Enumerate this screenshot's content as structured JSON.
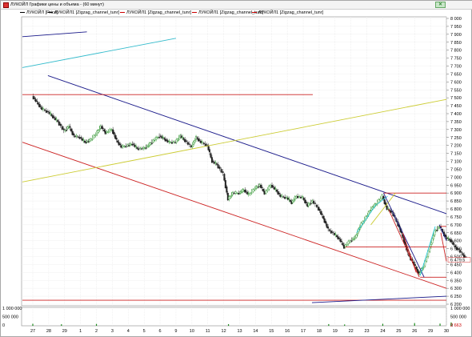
{
  "window": {
    "title": "ЛУКОЙЛ Графики цены и объема - (60 минут)",
    "close_label": "✕"
  },
  "legend": [
    {
      "label": "ЛУКОЙЛ [Price]",
      "color": "#000000"
    },
    {
      "label": "ЛУКОЙЛ1 [Zigzag_channel_tunr]",
      "color": "#000000"
    },
    {
      "label": "ЛУКОЙЛ1 [Zigzag_channel_tunr]",
      "color": "#cc0000"
    },
    {
      "label": "ЛУКОЙЛ1 [Zigzag_channel_tunr]",
      "color": "#cc0000"
    },
    {
      "label": "ЛУКОЙЛ1 [Zigzag_channel_tunr]",
      "color": "#cc0000"
    }
  ],
  "chart_data": {
    "type": "line",
    "series_type": "candlestick",
    "y_axis": {
      "ticks": [
        "8 000",
        "7 950",
        "7 900",
        "7 850",
        "7 800",
        "7 750",
        "7 700",
        "7 650",
        "7 600",
        "7 550",
        "7 500",
        "7 450",
        "7 400",
        "7 350",
        "7 300",
        "7 250",
        "7 200",
        "7 150",
        "7 100",
        "7 050",
        "7 000",
        "6 950",
        "6 900",
        "6 850",
        "6 800",
        "6 750",
        "6 700",
        "6 650",
        "6 600",
        "6 550",
        "6 500",
        "6 450",
        "6 400",
        "6 350",
        "6 300",
        "6 250",
        "6 200"
      ],
      "range": [
        6200,
        8000
      ],
      "step": 50
    },
    "x_axis": {
      "ticks": [
        "27",
        "28",
        "29",
        "1",
        "2",
        "3",
        "4",
        "5",
        "6",
        "9",
        "10",
        "11",
        "12",
        "13",
        "14",
        "15",
        "16",
        "17",
        "18",
        "19",
        "22",
        "23",
        "24",
        "25",
        "26",
        "29",
        "30"
      ]
    },
    "last_price_label": "6 479.5",
    "volume": {
      "ticks": [
        "1 000 000",
        "500 000",
        "0"
      ],
      "last_label": "2 663",
      "range": [
        0,
        1000000
      ]
    },
    "price_path": [
      [
        0,
        7510
      ],
      [
        0.3,
        7470
      ],
      [
        0.6,
        7430
      ],
      [
        1,
        7410
      ],
      [
        1.3,
        7380
      ],
      [
        1.6,
        7350
      ],
      [
        2,
        7290
      ],
      [
        2.3,
        7320
      ],
      [
        2.6,
        7260
      ],
      [
        3,
        7250
      ],
      [
        3.3,
        7220
      ],
      [
        3.6,
        7230
      ],
      [
        4,
        7270
      ],
      [
        4.3,
        7320
      ],
      [
        4.6,
        7280
      ],
      [
        5,
        7300
      ],
      [
        5.3,
        7230
      ],
      [
        5.6,
        7190
      ],
      [
        6,
        7200
      ],
      [
        6.3,
        7210
      ],
      [
        6.6,
        7180
      ],
      [
        7,
        7180
      ],
      [
        7.3,
        7200
      ],
      [
        7.6,
        7230
      ],
      [
        8,
        7260
      ],
      [
        8.3,
        7240
      ],
      [
        8.6,
        7220
      ],
      [
        9,
        7220
      ],
      [
        9.3,
        7260
      ],
      [
        9.6,
        7230
      ],
      [
        10,
        7190
      ],
      [
        10.3,
        7250
      ],
      [
        10.6,
        7220
      ],
      [
        11,
        7200
      ],
      [
        11.3,
        7100
      ],
      [
        11.6,
        7080
      ],
      [
        12,
        7020
      ],
      [
        12.3,
        6860
      ],
      [
        12.6,
        6900
      ],
      [
        13,
        6900
      ],
      [
        13.3,
        6920
      ],
      [
        13.6,
        6890
      ],
      [
        14,
        6930
      ],
      [
        14.3,
        6950
      ],
      [
        14.6,
        6900
      ],
      [
        15,
        6950
      ],
      [
        15.3,
        6920
      ],
      [
        15.6,
        6880
      ],
      [
        16,
        6870
      ],
      [
        16.3,
        6840
      ],
      [
        16.6,
        6880
      ],
      [
        17,
        6870
      ],
      [
        17.3,
        6820
      ],
      [
        17.6,
        6850
      ],
      [
        18,
        6800
      ],
      [
        18.3,
        6740
      ],
      [
        18.6,
        6670
      ],
      [
        19,
        6640
      ],
      [
        19.3,
        6610
      ],
      [
        19.6,
        6560
      ],
      [
        20,
        6600
      ],
      [
        20.3,
        6620
      ],
      [
        20.6,
        6690
      ],
      [
        21,
        6750
      ],
      [
        21.3,
        6800
      ],
      [
        21.6,
        6830
      ],
      [
        22,
        6880
      ],
      [
        22.3,
        6800
      ],
      [
        22.6,
        6780
      ],
      [
        23,
        6700
      ],
      [
        23.3,
        6620
      ],
      [
        23.6,
        6520
      ],
      [
        24,
        6450
      ],
      [
        24.3,
        6390
      ],
      [
        24.6,
        6440
      ],
      [
        25,
        6560
      ],
      [
        25.3,
        6660
      ],
      [
        25.6,
        6690
      ],
      [
        26,
        6620
      ],
      [
        26.3,
        6600
      ],
      [
        26.6,
        6560
      ],
      [
        27,
        6520
      ],
      [
        27.3,
        6480
      ]
    ],
    "volume_bars": [
      [
        0,
        120000
      ],
      [
        1.8,
        90000
      ],
      [
        4,
        110000
      ],
      [
        12.3,
        95000
      ],
      [
        18.6,
        100000
      ],
      [
        19.6,
        80000
      ],
      [
        22,
        120000
      ],
      [
        24,
        160000
      ],
      [
        25.6,
        130000
      ],
      [
        26.3,
        200000
      ]
    ],
    "lines": [
      {
        "name": "navy-short",
        "color": "#1a1a8a",
        "from": [
          0,
          7885
        ],
        "to": [
          3.4,
          7915
        ]
      },
      {
        "name": "cyan-top",
        "color": "#33bbcc",
        "from": [
          0,
          7690
        ],
        "to": [
          9,
          7875
        ]
      },
      {
        "name": "navy-channel-top",
        "color": "#1a1a8a",
        "from": [
          0.9,
          7640
        ],
        "to": [
          27.3,
          6770
        ]
      },
      {
        "name": "red-channel-bottom",
        "color": "#cc2222",
        "from": [
          0,
          7220
        ],
        "to": [
          27.3,
          6300
        ]
      },
      {
        "name": "yellow-channel",
        "color": "#cccc33",
        "from": [
          0,
          6970
        ],
        "to": [
          27.3,
          7490
        ]
      },
      {
        "name": "red-horizontal-top",
        "color": "#cc2222",
        "from": [
          0,
          7520
        ],
        "to": [
          17.6,
          7520
        ]
      },
      {
        "name": "red-horizontal-6900",
        "color": "#cc2222",
        "from": [
          22,
          6900
        ],
        "to": [
          27.3,
          6900
        ]
      },
      {
        "name": "red-horizontal-6690",
        "color": "#cc2222",
        "from": [
          25.5,
          6690
        ],
        "to": [
          27.3,
          6690
        ]
      },
      {
        "name": "red-horizontal-6560",
        "color": "#cc2222",
        "from": [
          19.6,
          6560
        ],
        "to": [
          27.3,
          6560
        ]
      },
      {
        "name": "red-horizontal-6370",
        "color": "#cc2222",
        "from": [
          24.3,
          6370
        ],
        "to": [
          27.3,
          6370
        ]
      },
      {
        "name": "red-horizontal-6230",
        "color": "#cc2222",
        "from": [
          0,
          6225
        ],
        "to": [
          27.3,
          6225
        ]
      },
      {
        "name": "navy-bottom",
        "color": "#1a1a8a",
        "from": [
          17.5,
          6210
        ],
        "to": [
          27.3,
          6250
        ]
      },
      {
        "name": "cyan-1",
        "color": "#33ccdd",
        "from": [
          20.3,
          6650
        ],
        "to": [
          21.6,
          6830
        ]
      },
      {
        "name": "cyan-2",
        "color": "#33ccdd",
        "from": [
          21.6,
          6830
        ],
        "to": [
          22.3,
          6880
        ]
      },
      {
        "name": "yellow-1",
        "color": "#cccc33",
        "from": [
          21.2,
          6700
        ],
        "to": [
          22.8,
          6900
        ]
      },
      {
        "name": "navy-down-1",
        "color": "#1a1a8a",
        "from": [
          22,
          6900
        ],
        "to": [
          24.6,
          6370
        ]
      },
      {
        "name": "red-down-1",
        "color": "#cc2222",
        "from": [
          22.3,
          6800
        ],
        "to": [
          24.3,
          6370
        ]
      },
      {
        "name": "red-down-2",
        "color": "#cc2222",
        "from": [
          23.2,
          6650
        ],
        "to": [
          24.1,
          6400
        ]
      },
      {
        "name": "cyan-3",
        "color": "#33ccdd",
        "from": [
          24.3,
          6380
        ],
        "to": [
          25.3,
          6690
        ]
      },
      {
        "name": "navy-right",
        "color": "#1a1a8a",
        "from": [
          25.5,
          6700
        ],
        "to": [
          27.3,
          6600
        ]
      },
      {
        "name": "red-right",
        "color": "#cc2222",
        "from": [
          25.6,
          6650
        ],
        "to": [
          27.3,
          6470
        ]
      }
    ]
  }
}
